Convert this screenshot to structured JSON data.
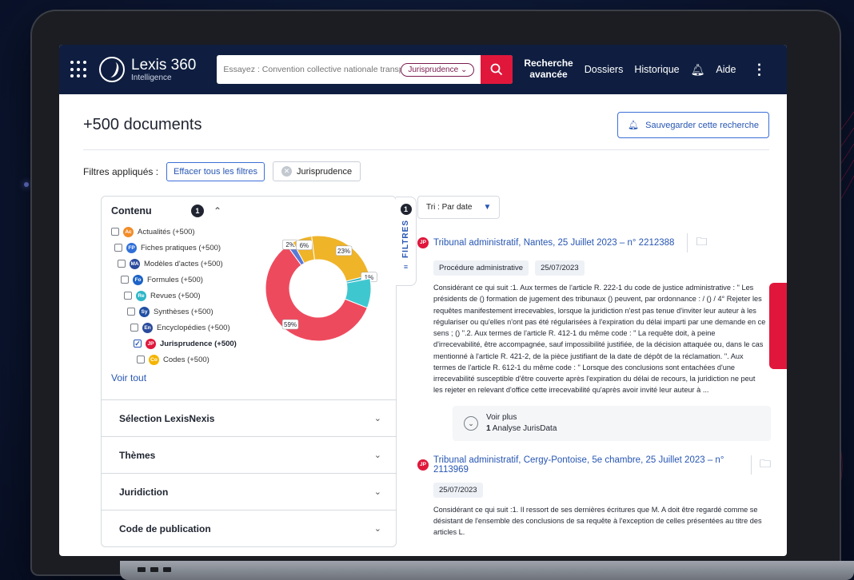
{
  "topbar": {
    "brand": "Lexis 360",
    "brand_sub": "Intelligence",
    "search_placeholder": "Essayez : Convention collective nationale transport",
    "search_chip": "Jurisprudence",
    "advanced_1": "Recherche",
    "advanced_2": "avancée",
    "nav_dossiers": "Dossiers",
    "nav_historique": "Historique",
    "nav_aide": "Aide"
  },
  "header": {
    "doc_count": "+500 documents",
    "save_search": "Sauvegarder cette recherche"
  },
  "filters": {
    "label": "Filtres appliqués :",
    "clear_all": "Effacer tous les filtres",
    "applied_chip": "Jurisprudence"
  },
  "sidebar": {
    "contenu_title": "Contenu",
    "contenu_count": "1",
    "filters_tab_label": "FILTRES",
    "filters_tab_count": "1",
    "items": [
      {
        "label": "Actualités (+500)",
        "abbr": "Ac",
        "color": "#f28c28",
        "checked": false
      },
      {
        "label": "Fiches pratiques (+500)",
        "abbr": "FP",
        "color": "#2f6fd8",
        "checked": false
      },
      {
        "label": "Modèles d'actes (+500)",
        "abbr": "MA",
        "color": "#2a4a9c",
        "checked": false
      },
      {
        "label": "Formules (+500)",
        "abbr": "Fo",
        "color": "#1c63c8",
        "checked": false
      },
      {
        "label": "Revues (+500)",
        "abbr": "Re",
        "color": "#2fb6c8",
        "checked": false
      },
      {
        "label": "Synthèses (+500)",
        "abbr": "Sy",
        "color": "#1f4fa3",
        "checked": false
      },
      {
        "label": "Encyclopédies (+500)",
        "abbr": "En",
        "color": "#2a4a9c",
        "checked": false
      },
      {
        "label": "Jurisprudence (+500)",
        "abbr": "JP",
        "color": "#e0173b",
        "checked": true
      },
      {
        "label": "Codes (+500)",
        "abbr": "Co",
        "color": "#f5b400",
        "checked": false
      }
    ],
    "see_all": "Voir tout",
    "accordions": [
      "Sélection LexisNexis",
      "Thèmes",
      "Juridiction",
      "Code de publication"
    ]
  },
  "chart_data": {
    "type": "pie",
    "categories": [
      "59%",
      "2%",
      "6%",
      "23%",
      "1%",
      ""
    ],
    "values": [
      59,
      2,
      6,
      23,
      1,
      9
    ],
    "colors": [
      "#ee4a5e",
      "#5a7ad8",
      "#f0b429",
      "#f0b429",
      "#2fb6c8",
      "#3fc7d0"
    ]
  },
  "results": {
    "sort_label": "Tri : Par date",
    "items": [
      {
        "title": "Tribunal administratif, Nantes, 25 Juillet 2023 – n° 2212388",
        "tags": [
          "Procédure administrative",
          "25/07/2023"
        ],
        "excerpt": "Considérant ce qui suit :1. Aux termes de l'article R. 222-1 du code de justice administrative : \" Les présidents de () formation de jugement des tribunaux () peuvent, par ordonnance : / () / 4° Rejeter les requêtes manifestement irrecevables, lorsque la juridiction n'est pas tenue d'inviter leur auteur à les régulariser ou qu'elles n'ont pas été régularisées à l'expiration du délai imparti par une demande en ce sens ; () \".2. Aux termes de l'article R. 412-1 du même code : \" La requête doit, à peine d'irrecevabilité, être accompagnée, sauf impossibilité justifiée, de la décision attaquée ou, dans le cas mentionné à l'article R. 421-2, de la pièce justifiant de la date de dépôt de la réclamation. \". Aux termes de l'article R. 612-1 du même code : \" Lorsque des conclusions sont entachées d'une irrecevabilité susceptible d'être couverte après l'expiration du délai de recours, la juridiction ne peut les rejeter en relevant d'office cette irrecevabilité qu'après avoir invité leur auteur à ...",
        "voir_plus": "Voir plus",
        "analyse_count": "1",
        "analyse_label": "Analyse JurisData"
      },
      {
        "title": "Tribunal administratif, Cergy-Pontoise, 5e chambre, 25 Juillet 2023 – n° 2113969",
        "tags": [
          "25/07/2023"
        ],
        "excerpt": "Considérant ce qui suit :1. Il ressort de ses dernières écritures que M. A doit être regardé comme se désistant de l'ensemble des conclusions de sa requête à l'exception de celles présentées au titre des articles L."
      }
    ]
  }
}
